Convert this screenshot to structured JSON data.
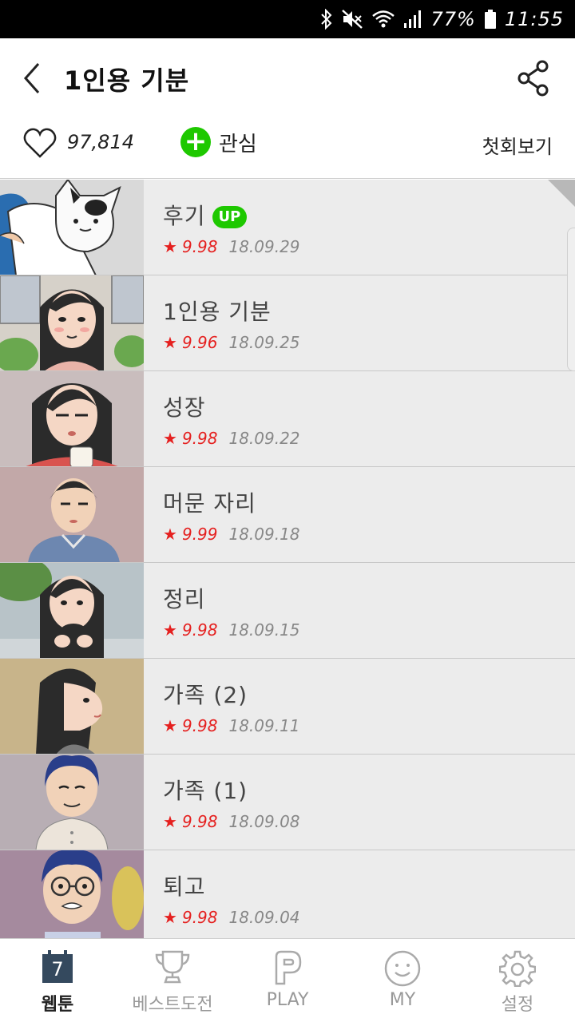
{
  "status_bar": {
    "icons": [
      "bluetooth-icon",
      "mute-icon",
      "wifi-icon",
      "signal-icon",
      "battery-icon"
    ],
    "battery_percent": "77%",
    "time": "11:55"
  },
  "header": {
    "title": "1인용 기분",
    "back_icon": "chevron-left-icon",
    "share_icon": "share-icon"
  },
  "actions": {
    "like_count": "97,814",
    "favorite_label": "관심",
    "first_episode_label": "첫회보기"
  },
  "episodes": [
    {
      "title": "후기",
      "badge": "UP",
      "rating": "9.98",
      "date": "18.09.29"
    },
    {
      "title": "1인용 기분",
      "badge": "",
      "rating": "9.96",
      "date": "18.09.25"
    },
    {
      "title": "성장",
      "badge": "",
      "rating": "9.98",
      "date": "18.09.22"
    },
    {
      "title": "머문 자리",
      "badge": "",
      "rating": "9.99",
      "date": "18.09.18"
    },
    {
      "title": "정리",
      "badge": "",
      "rating": "9.98",
      "date": "18.09.15"
    },
    {
      "title": "가족 (2)",
      "badge": "",
      "rating": "9.98",
      "date": "18.09.11"
    },
    {
      "title": "가족 (1)",
      "badge": "",
      "rating": "9.98",
      "date": "18.09.08"
    },
    {
      "title": "퇴고",
      "badge": "",
      "rating": "9.98",
      "date": "18.09.04"
    }
  ],
  "bottom_nav": {
    "webtoon": {
      "label": "웹툰",
      "icon_text": "7"
    },
    "best": {
      "label": "베스트도전"
    },
    "play": {
      "label": "PLAY"
    },
    "my": {
      "label": "MY"
    },
    "settings": {
      "label": "설정"
    }
  },
  "colors": {
    "accent_green": "#1ec800",
    "rating_red": "#e5201f",
    "list_bg": "#ececec"
  }
}
